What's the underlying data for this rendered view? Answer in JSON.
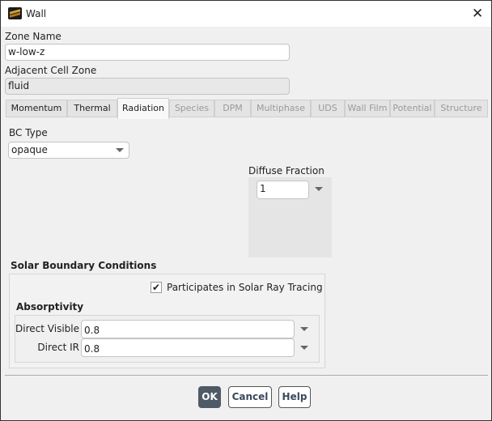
{
  "window": {
    "title": "Wall",
    "icon": "fluent-logo-icon",
    "close_icon": "close-icon"
  },
  "zone_name": {
    "label": "Zone Name",
    "value": "w-low-z"
  },
  "adjacent_cell_zone": {
    "label": "Adjacent Cell Zone",
    "value": "fluid"
  },
  "tabs": [
    {
      "label": "Momentum",
      "enabled": true
    },
    {
      "label": "Thermal",
      "enabled": true
    },
    {
      "label": "Radiation",
      "enabled": true,
      "active": true
    },
    {
      "label": "Species",
      "enabled": false
    },
    {
      "label": "DPM",
      "enabled": false
    },
    {
      "label": "Multiphase",
      "enabled": false
    },
    {
      "label": "UDS",
      "enabled": false
    },
    {
      "label": "Wall Film",
      "enabled": false
    },
    {
      "label": "Potential",
      "enabled": false
    },
    {
      "label": "Structure",
      "enabled": false
    }
  ],
  "radiation": {
    "bc_type": {
      "label": "BC Type",
      "value": "opaque"
    },
    "diffuse_fraction": {
      "label": "Diffuse Fraction",
      "value": "1"
    },
    "solar": {
      "title": "Solar Boundary Conditions",
      "participates": {
        "label": "Participates in Solar Ray Tracing",
        "checked": true
      },
      "absorptivity": {
        "title": "Absorptivity",
        "direct_visible": {
          "label": "Direct Visible",
          "value": "0.8"
        },
        "direct_ir": {
          "label": "Direct IR",
          "value": "0.8"
        }
      }
    }
  },
  "buttons": {
    "ok": "OK",
    "cancel": "Cancel",
    "help": "Help"
  }
}
